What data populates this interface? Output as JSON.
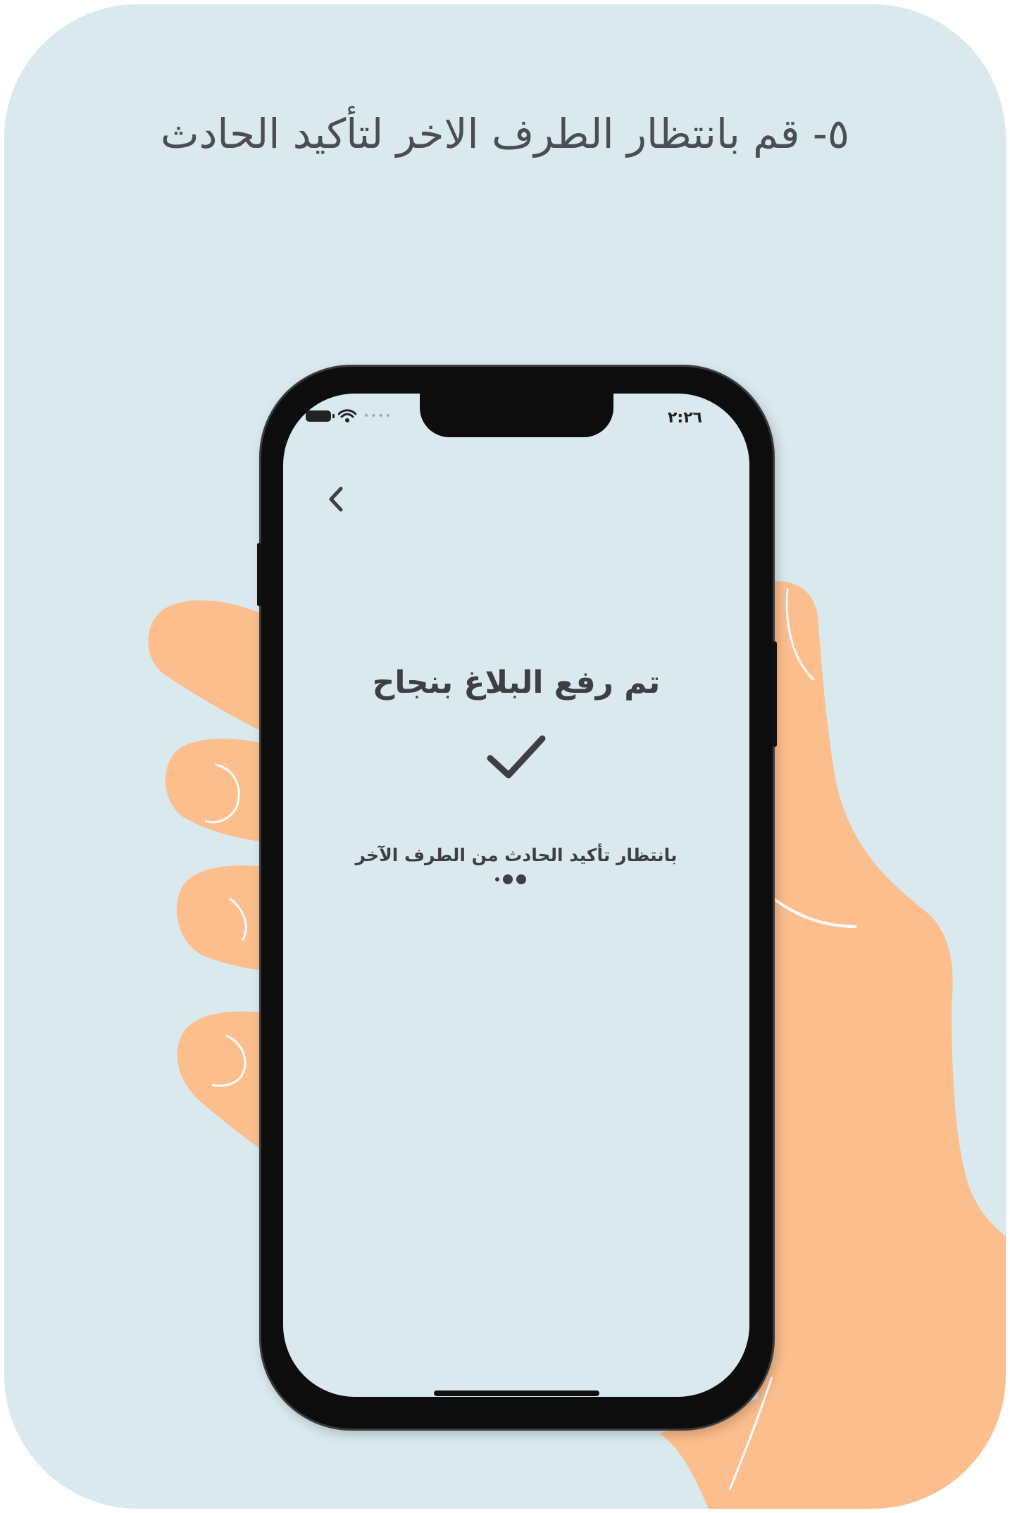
{
  "colors": {
    "background": "#d9e9ee",
    "skin": "#fcbe8c",
    "phone_frame": "#0d0d0d",
    "text": "#3d3f43"
  },
  "instruction": {
    "title": "٥- قم بانتظار الطرف الاخر لتأكيد الحادث"
  },
  "status_bar": {
    "time": "٢:٢٦",
    "icons": [
      "battery-icon",
      "wifi-icon",
      "signal-icon"
    ]
  },
  "app": {
    "back_icon": "chevron-left-icon",
    "success_title": "تم رفع البلاغ بنجاح",
    "status_icon": "checkmark-icon",
    "waiting_text": "بانتظار تأكيد الحادث من الطرف الآخر",
    "loading_icon": "loading-dots-icon"
  }
}
